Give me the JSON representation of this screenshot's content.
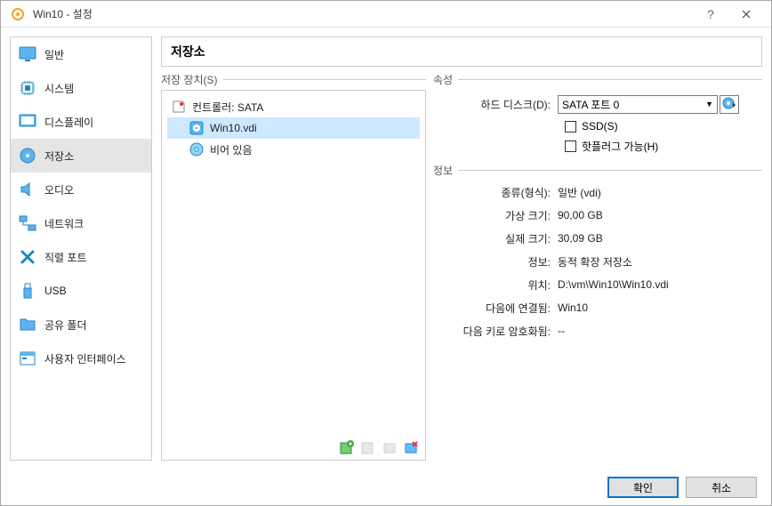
{
  "window": {
    "title": "Win10 - 설정"
  },
  "sidebar": {
    "items": [
      {
        "label": "일반"
      },
      {
        "label": "시스템"
      },
      {
        "label": "디스플레이"
      },
      {
        "label": "저장소"
      },
      {
        "label": "오디오"
      },
      {
        "label": "네트워크"
      },
      {
        "label": "직렬 포트"
      },
      {
        "label": "USB"
      },
      {
        "label": "공유 폴더"
      },
      {
        "label": "사용자 인터페이스"
      }
    ]
  },
  "main": {
    "page_title": "저장소",
    "left_panel_header": "저장 장치(S)",
    "right_panel_header": "속성",
    "tree": {
      "controller_label": "컨트롤러: SATA",
      "disk_label": "Win10.vdi",
      "empty_label": "비어 있음"
    },
    "attrs": {
      "hard_disk_label": "하드 디스크(D):",
      "hard_disk_value": "SATA 포트 0",
      "ssd_label": "SSD(S)",
      "hotplug_label": "핫플러그 가능(H)"
    },
    "info": {
      "section_label": "정보",
      "type_label": "종류(형식):",
      "type_value": "일반 (vdi)",
      "virtsize_label": "가상 크기:",
      "virtsize_value": "90,00 GB",
      "realsize_label": "실제 크기:",
      "realsize_value": "30,09 GB",
      "info_label": "정보:",
      "info_value": "동적 확장 저장소",
      "loc_label": "위치:",
      "loc_value": "D:\\vm\\Win10\\Win10.vdi",
      "attached_label": "다음에 연결됨:",
      "attached_value": "Win10",
      "encrypted_label": "다음 키로 암호화됨:",
      "encrypted_value": "--"
    }
  },
  "footer": {
    "ok": "확인",
    "cancel": "취소"
  }
}
